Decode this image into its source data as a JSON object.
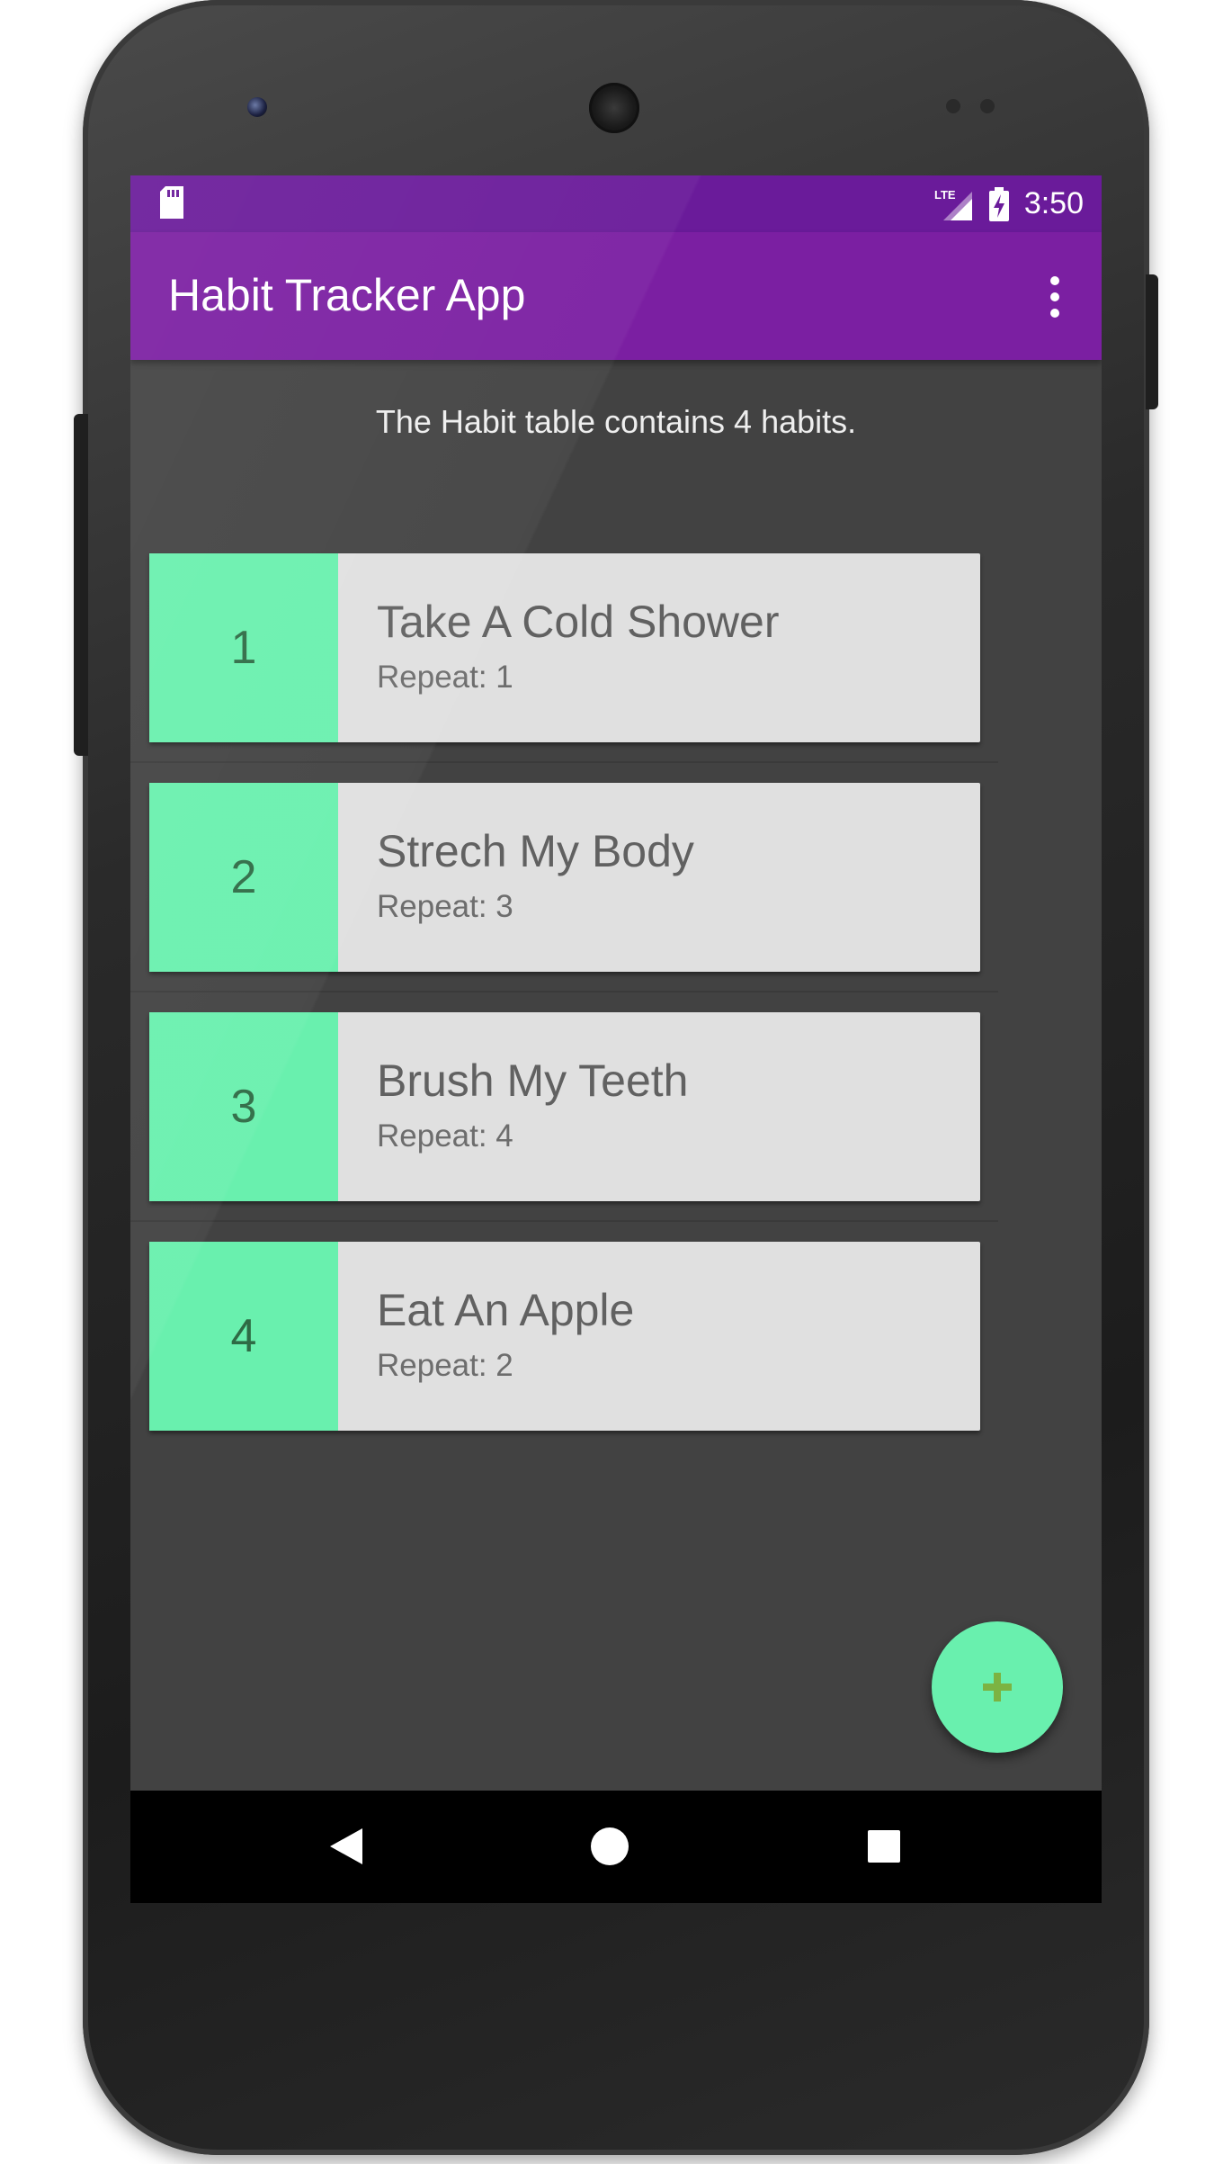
{
  "status_bar": {
    "network": "LTE",
    "time": "3:50"
  },
  "app_bar": {
    "title": "Habit Tracker App",
    "menu_icon": "more-vert-icon"
  },
  "summary": {
    "text": "The Habit table contains 4 habits."
  },
  "habits": [
    {
      "id": "1",
      "name": "Take A Cold Shower",
      "repeat": "Repeat: 1"
    },
    {
      "id": "2",
      "name": "Strech My Body",
      "repeat": "Repeat: 3"
    },
    {
      "id": "3",
      "name": "Brush My Teeth",
      "repeat": "Repeat: 4"
    },
    {
      "id": "4",
      "name": "Eat An Apple",
      "repeat": "Repeat: 2"
    }
  ],
  "fab": {
    "icon": "plus-icon",
    "icon_color": "#7cb342"
  },
  "nav_bar": {
    "icons": [
      "back-icon",
      "home-icon",
      "recents-icon"
    ]
  },
  "colors": {
    "primary": "#7b1fa2",
    "primary_dark": "#6a1b9a",
    "accent": "#69f0ae",
    "background": "#424242",
    "card": "#e0e0e0"
  }
}
